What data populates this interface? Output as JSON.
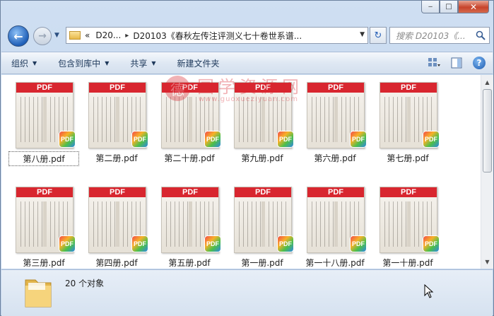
{
  "window": {
    "caption_min": "‒",
    "caption_max": "□",
    "caption_close": "✕"
  },
  "nav": {
    "back_glyph": "←",
    "forward_glyph": "→",
    "dropdown_glyph": "▼",
    "address_prefix": "«",
    "address_segment_1": "D20...",
    "address_sep": "▸",
    "address_segment_2": "D20103《春秋左传注评测义七十卷世系谱...",
    "address_drop": "▼",
    "refresh_glyph": "↻",
    "search_placeholder": "搜索 D20103《..."
  },
  "toolbar": {
    "organize": "组织",
    "include_library": "包含到库中",
    "share": "共享",
    "new_folder": "新建文件夹",
    "caret": "▼",
    "view_icon": "view-options-icon",
    "preview_icon": "preview-pane-icon",
    "help_glyph": "?"
  },
  "files": [
    {
      "name": "第八册.pdf",
      "selected": true
    },
    {
      "name": "第二册.pdf"
    },
    {
      "name": "第二十册.pdf"
    },
    {
      "name": "第九册.pdf"
    },
    {
      "name": "第六册.pdf"
    },
    {
      "name": "第七册.pdf"
    },
    {
      "name": "第三册.pdf"
    },
    {
      "name": "第四册.pdf"
    },
    {
      "name": "第五册.pdf"
    },
    {
      "name": "第一册.pdf"
    },
    {
      "name": "第一十八册.pdf"
    },
    {
      "name": "第一十册.pdf"
    }
  ],
  "thumb_band": "PDF",
  "thumb_badge": "PDF",
  "watermark": {
    "seal": "德",
    "text": "国学资源网",
    "url": "www.guoxueziyuan.com"
  },
  "scrollbar": {
    "up": "▲",
    "down": "▼"
  },
  "details": {
    "item_count": "20 个对象"
  },
  "colors": {
    "pdf_red": "#d8262f",
    "toolbar_text": "#1e395b",
    "window_frame": "#bcd0ea"
  }
}
